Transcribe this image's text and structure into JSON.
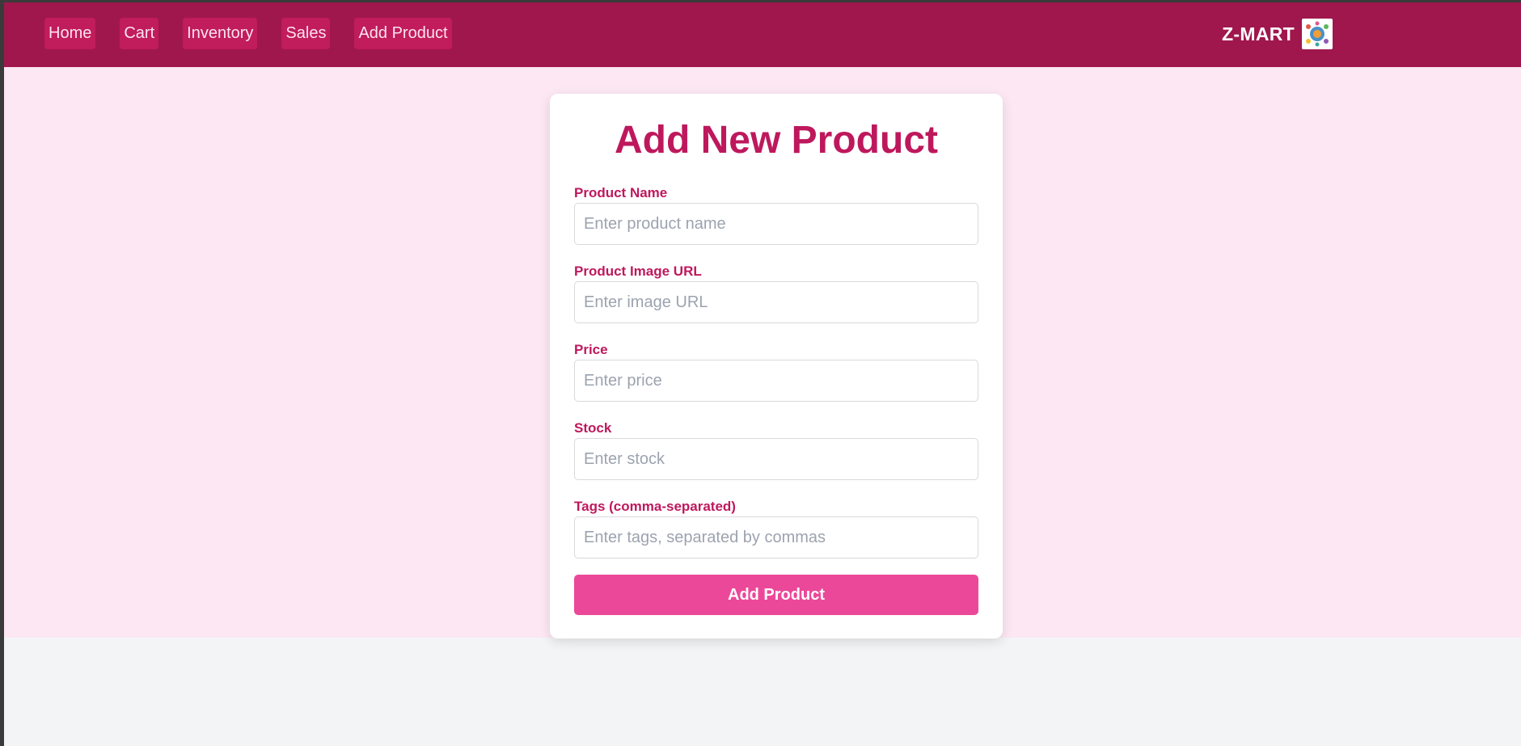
{
  "nav": {
    "links": [
      "Home",
      "Cart",
      "Inventory",
      "Sales",
      "Add Product"
    ],
    "brand": "Z-MART",
    "logo_icon": "store-logo-icon"
  },
  "form": {
    "title": "Add New Product",
    "fields": {
      "name": {
        "label": "Product Name",
        "placeholder": "Enter product name",
        "value": ""
      },
      "image": {
        "label": "Product Image URL",
        "placeholder": "Enter image URL",
        "value": ""
      },
      "price": {
        "label": "Price",
        "placeholder": "Enter price",
        "value": ""
      },
      "stock": {
        "label": "Stock",
        "placeholder": "Enter stock",
        "value": ""
      },
      "tags": {
        "label": "Tags (comma-separated)",
        "placeholder": "Enter tags, separated by commas",
        "value": ""
      }
    },
    "submit_label": "Add Product"
  },
  "colors": {
    "navbar": "#a0174d",
    "nav_link_bg": "#c11c5c",
    "page_bg": "#fce7f3",
    "accent": "#be185d",
    "button": "#ec4899"
  }
}
